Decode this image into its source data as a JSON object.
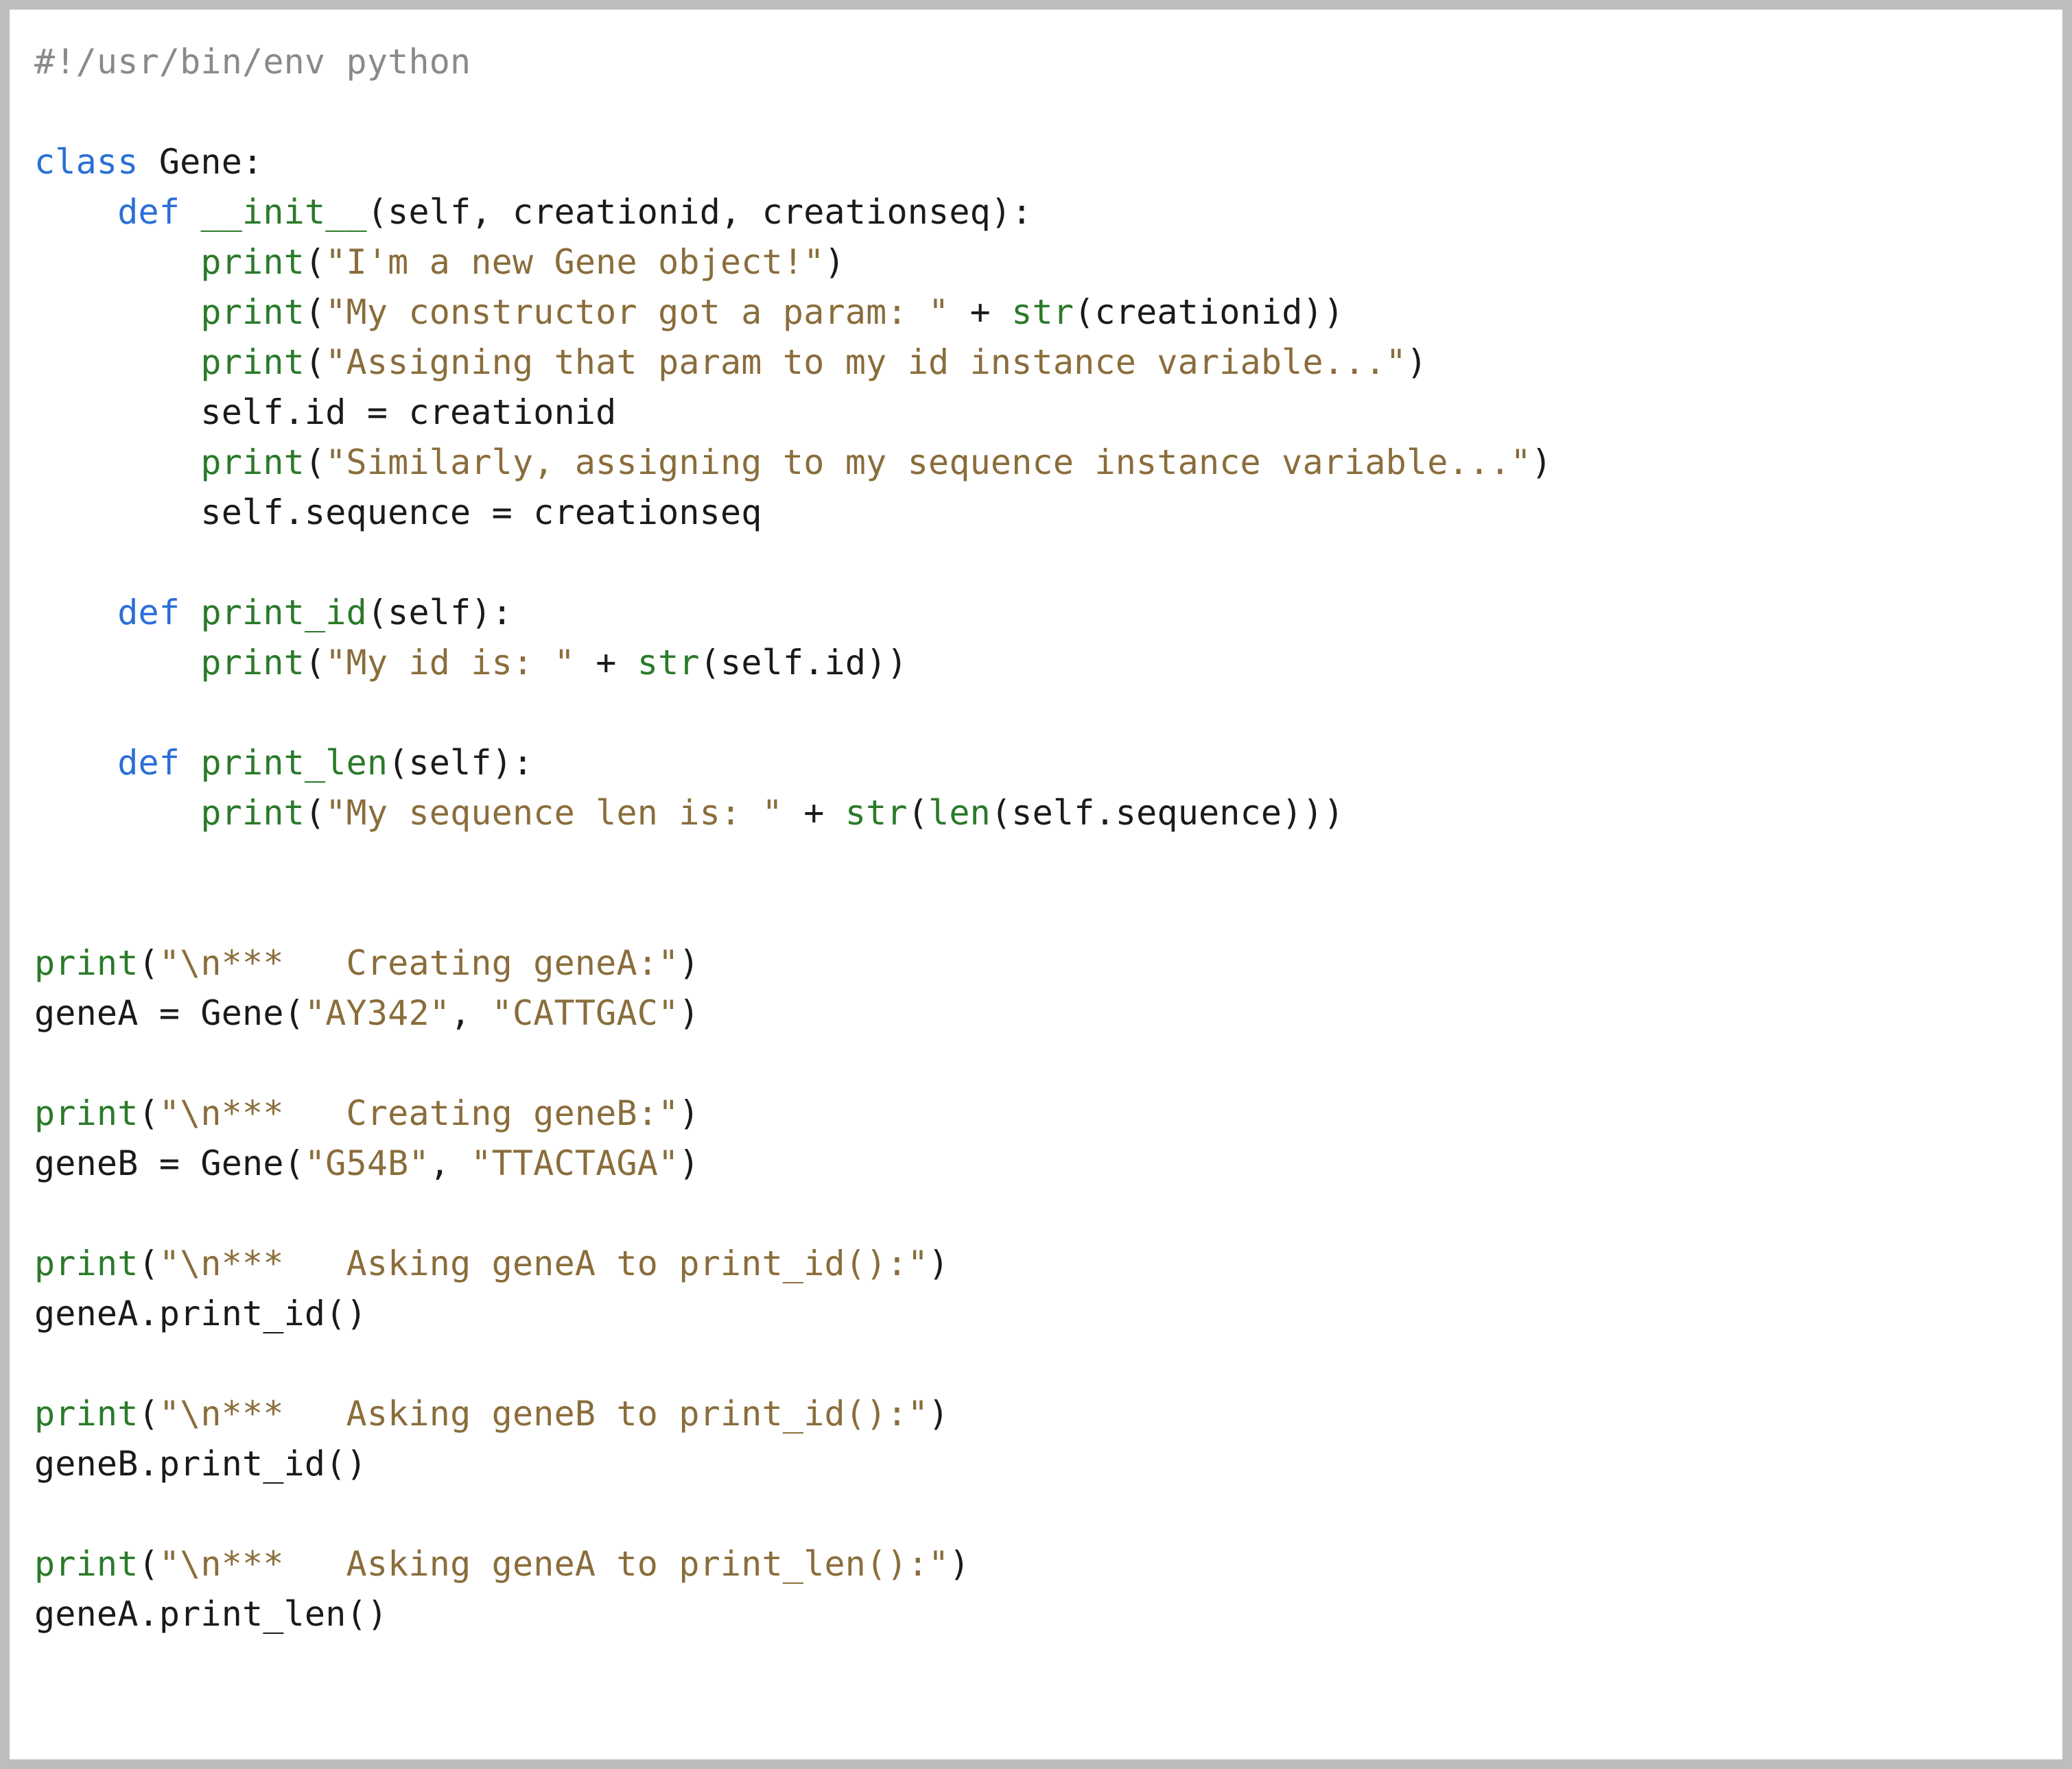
{
  "code": {
    "lines": [
      {
        "indent": 0,
        "tokens": [
          {
            "cls": "c-comment",
            "text": "#!/usr/bin/env python"
          }
        ]
      },
      {
        "indent": 0,
        "tokens": []
      },
      {
        "indent": 0,
        "tokens": [
          {
            "cls": "c-keyword",
            "text": "class"
          },
          {
            "cls": "c-default",
            "text": " "
          },
          {
            "cls": "c-classname",
            "text": "Gene"
          },
          {
            "cls": "c-default",
            "text": ":"
          }
        ]
      },
      {
        "indent": 1,
        "tokens": [
          {
            "cls": "c-keyword",
            "text": "def"
          },
          {
            "cls": "c-default",
            "text": " "
          },
          {
            "cls": "c-dunder",
            "text": "__init__"
          },
          {
            "cls": "c-default",
            "text": "(self, creationid, creationseq):"
          }
        ]
      },
      {
        "indent": 2,
        "tokens": [
          {
            "cls": "c-func",
            "text": "print"
          },
          {
            "cls": "c-default",
            "text": "("
          },
          {
            "cls": "c-string",
            "text": "\"I'm a new Gene object!\""
          },
          {
            "cls": "c-default",
            "text": ")"
          }
        ]
      },
      {
        "indent": 2,
        "tokens": [
          {
            "cls": "c-func",
            "text": "print"
          },
          {
            "cls": "c-default",
            "text": "("
          },
          {
            "cls": "c-string",
            "text": "\"My constructor got a param: \""
          },
          {
            "cls": "c-default",
            "text": " + "
          },
          {
            "cls": "c-builtin",
            "text": "str"
          },
          {
            "cls": "c-default",
            "text": "(creationid))"
          }
        ]
      },
      {
        "indent": 2,
        "tokens": [
          {
            "cls": "c-func",
            "text": "print"
          },
          {
            "cls": "c-default",
            "text": "("
          },
          {
            "cls": "c-string",
            "text": "\"Assigning that param to my id instance variable...\""
          },
          {
            "cls": "c-default",
            "text": ")"
          }
        ]
      },
      {
        "indent": 2,
        "tokens": [
          {
            "cls": "c-default",
            "text": "self.id = creationid"
          }
        ]
      },
      {
        "indent": 2,
        "tokens": [
          {
            "cls": "c-func",
            "text": "print"
          },
          {
            "cls": "c-default",
            "text": "("
          },
          {
            "cls": "c-string",
            "text": "\"Similarly, assigning to my sequence instance variable...\""
          },
          {
            "cls": "c-default",
            "text": ")"
          }
        ]
      },
      {
        "indent": 2,
        "tokens": [
          {
            "cls": "c-default",
            "text": "self.sequence = creationseq"
          }
        ]
      },
      {
        "indent": 0,
        "tokens": []
      },
      {
        "indent": 1,
        "tokens": [
          {
            "cls": "c-keyword",
            "text": "def"
          },
          {
            "cls": "c-default",
            "text": " "
          },
          {
            "cls": "c-func",
            "text": "print_id"
          },
          {
            "cls": "c-default",
            "text": "(self):"
          }
        ]
      },
      {
        "indent": 2,
        "tokens": [
          {
            "cls": "c-func",
            "text": "print"
          },
          {
            "cls": "c-default",
            "text": "("
          },
          {
            "cls": "c-string",
            "text": "\"My id is: \""
          },
          {
            "cls": "c-default",
            "text": " + "
          },
          {
            "cls": "c-builtin",
            "text": "str"
          },
          {
            "cls": "c-default",
            "text": "(self.id))"
          }
        ]
      },
      {
        "indent": 0,
        "tokens": []
      },
      {
        "indent": 1,
        "tokens": [
          {
            "cls": "c-keyword",
            "text": "def"
          },
          {
            "cls": "c-default",
            "text": " "
          },
          {
            "cls": "c-func",
            "text": "print_len"
          },
          {
            "cls": "c-default",
            "text": "(self):"
          }
        ]
      },
      {
        "indent": 2,
        "tokens": [
          {
            "cls": "c-func",
            "text": "print"
          },
          {
            "cls": "c-default",
            "text": "("
          },
          {
            "cls": "c-string",
            "text": "\"My sequence len is: \""
          },
          {
            "cls": "c-default",
            "text": " + "
          },
          {
            "cls": "c-builtin",
            "text": "str"
          },
          {
            "cls": "c-default",
            "text": "("
          },
          {
            "cls": "c-builtin",
            "text": "len"
          },
          {
            "cls": "c-default",
            "text": "(self.sequence)))"
          }
        ]
      },
      {
        "indent": 0,
        "tokens": []
      },
      {
        "indent": 0,
        "tokens": []
      },
      {
        "indent": 0,
        "tokens": [
          {
            "cls": "c-func",
            "text": "print"
          },
          {
            "cls": "c-default",
            "text": "("
          },
          {
            "cls": "c-string",
            "text": "\"\\n***   Creating geneA:\""
          },
          {
            "cls": "c-default",
            "text": ")"
          }
        ]
      },
      {
        "indent": 0,
        "tokens": [
          {
            "cls": "c-default",
            "text": "geneA = Gene("
          },
          {
            "cls": "c-string",
            "text": "\"AY342\""
          },
          {
            "cls": "c-default",
            "text": ", "
          },
          {
            "cls": "c-string",
            "text": "\"CATTGAC\""
          },
          {
            "cls": "c-default",
            "text": ")"
          }
        ]
      },
      {
        "indent": 0,
        "tokens": []
      },
      {
        "indent": 0,
        "tokens": [
          {
            "cls": "c-func",
            "text": "print"
          },
          {
            "cls": "c-default",
            "text": "("
          },
          {
            "cls": "c-string",
            "text": "\"\\n***   Creating geneB:\""
          },
          {
            "cls": "c-default",
            "text": ")"
          }
        ]
      },
      {
        "indent": 0,
        "tokens": [
          {
            "cls": "c-default",
            "text": "geneB = Gene("
          },
          {
            "cls": "c-string",
            "text": "\"G54B\""
          },
          {
            "cls": "c-default",
            "text": ", "
          },
          {
            "cls": "c-string",
            "text": "\"TTACTAGA\""
          },
          {
            "cls": "c-default",
            "text": ")"
          }
        ]
      },
      {
        "indent": 0,
        "tokens": []
      },
      {
        "indent": 0,
        "tokens": [
          {
            "cls": "c-func",
            "text": "print"
          },
          {
            "cls": "c-default",
            "text": "("
          },
          {
            "cls": "c-string",
            "text": "\"\\n***   Asking geneA to print_id():\""
          },
          {
            "cls": "c-default",
            "text": ")"
          }
        ]
      },
      {
        "indent": 0,
        "tokens": [
          {
            "cls": "c-default",
            "text": "geneA.print_id()"
          }
        ]
      },
      {
        "indent": 0,
        "tokens": []
      },
      {
        "indent": 0,
        "tokens": [
          {
            "cls": "c-func",
            "text": "print"
          },
          {
            "cls": "c-default",
            "text": "("
          },
          {
            "cls": "c-string",
            "text": "\"\\n***   Asking geneB to print_id():\""
          },
          {
            "cls": "c-default",
            "text": ")"
          }
        ]
      },
      {
        "indent": 0,
        "tokens": [
          {
            "cls": "c-default",
            "text": "geneB.print_id()"
          }
        ]
      },
      {
        "indent": 0,
        "tokens": []
      },
      {
        "indent": 0,
        "tokens": [
          {
            "cls": "c-func",
            "text": "print"
          },
          {
            "cls": "c-default",
            "text": "("
          },
          {
            "cls": "c-string",
            "text": "\"\\n***   Asking geneA to print_len():\""
          },
          {
            "cls": "c-default",
            "text": ")"
          }
        ]
      },
      {
        "indent": 0,
        "tokens": [
          {
            "cls": "c-default",
            "text": "geneA.print_len()"
          }
        ]
      }
    ]
  }
}
